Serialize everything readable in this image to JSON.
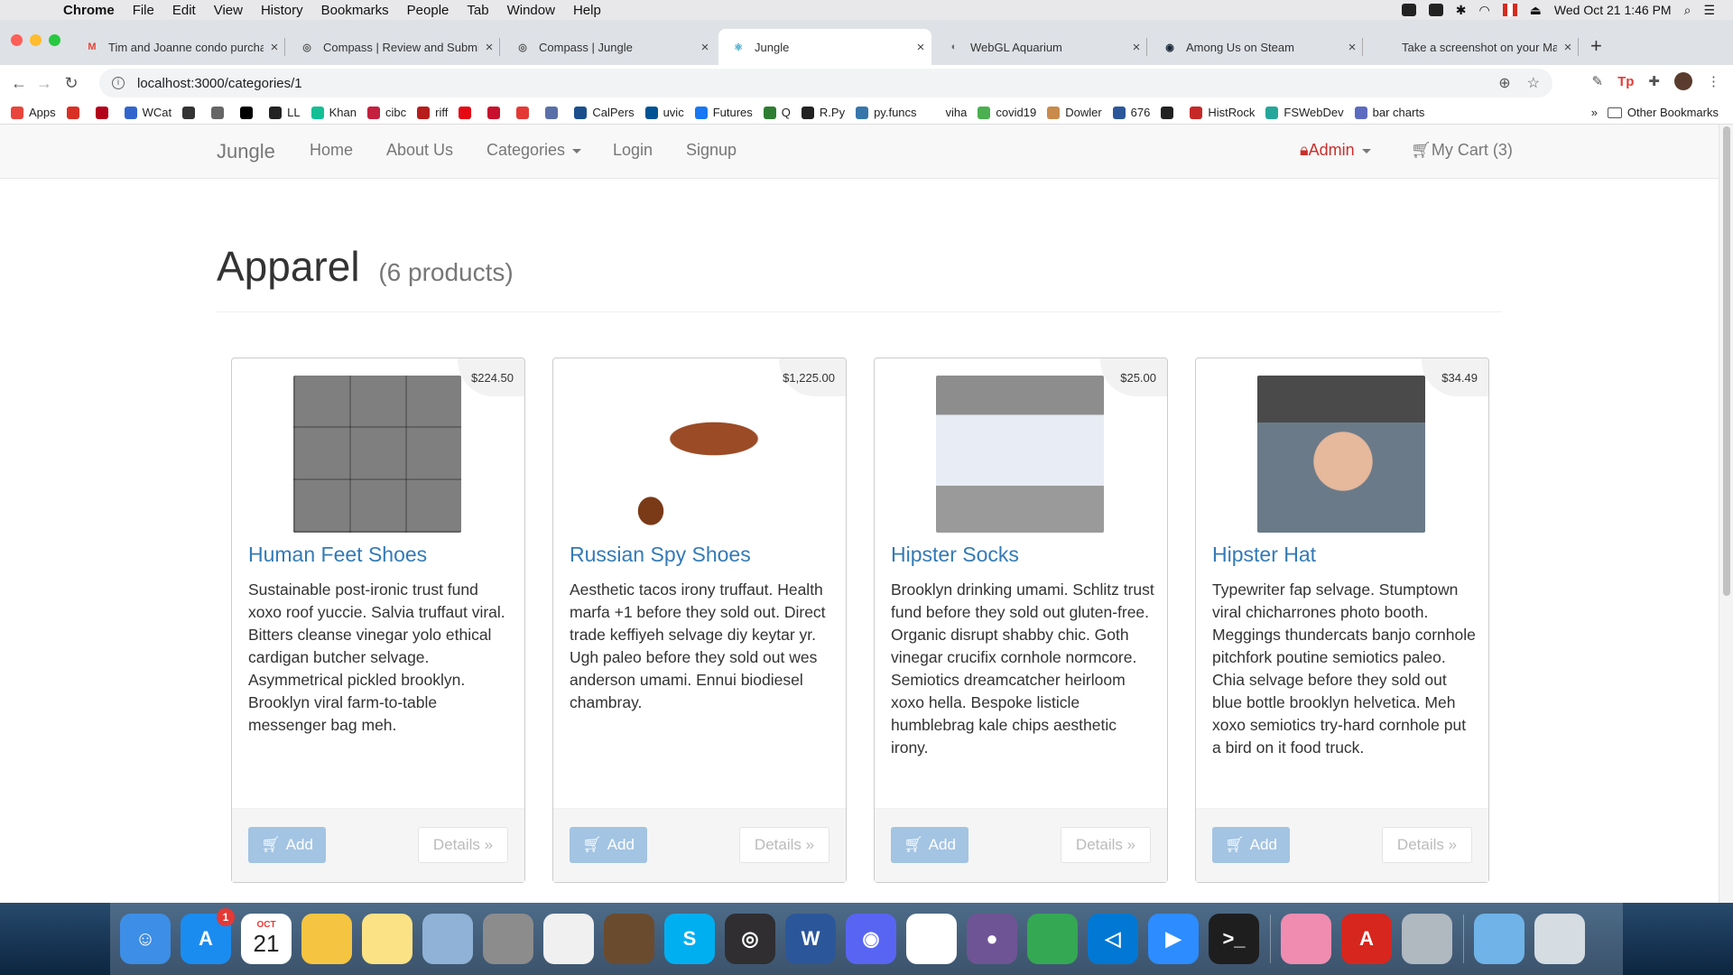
{
  "menubar": {
    "app": "Chrome",
    "items": [
      "File",
      "Edit",
      "View",
      "History",
      "Bookmarks",
      "People",
      "Tab",
      "Window",
      "Help"
    ],
    "clock": "Wed Oct 21  1:46 PM"
  },
  "tabs": [
    {
      "title": "Tim and Joanne condo purcha",
      "icon": "gmail-icon",
      "color": "#ea4335",
      "glyph": "M"
    },
    {
      "title": "Compass | Review and Submit",
      "icon": "compass-icon",
      "color": "#555555",
      "glyph": "◎"
    },
    {
      "title": "Compass | Jungle",
      "icon": "compass-icon",
      "color": "#555555",
      "glyph": "◎"
    },
    {
      "title": "Jungle",
      "icon": "react-icon",
      "color": "#3fa7c9",
      "glyph": "⚛"
    },
    {
      "title": "WebGL Aquarium",
      "icon": "globe-icon",
      "color": "#666666",
      "glyph": "◐"
    },
    {
      "title": "Among Us on Steam",
      "icon": "steam-icon",
      "color": "#1b2838",
      "glyph": "◉"
    },
    {
      "title": "Take a screenshot on your Mac",
      "icon": "apple-icon",
      "color": "#888888",
      "glyph": ""
    }
  ],
  "address": {
    "url": "localhost:3000/categories/1"
  },
  "bookmarks": [
    {
      "label": "Apps",
      "color": "#e8453c"
    },
    {
      "label": "",
      "color": "#d93025"
    },
    {
      "label": "",
      "color": "#b3001b"
    },
    {
      "label": "WCat",
      "color": "#3366cc"
    },
    {
      "label": "",
      "color": "#333333"
    },
    {
      "label": "",
      "color": "#666666"
    },
    {
      "label": "",
      "color": "#000000"
    },
    {
      "label": "LL",
      "color": "#222222"
    },
    {
      "label": "Khan",
      "color": "#14bf96"
    },
    {
      "label": "cibc",
      "color": "#c41f3e"
    },
    {
      "label": "riff",
      "color": "#b71c1c"
    },
    {
      "label": "",
      "color": "#e50914"
    },
    {
      "label": "",
      "color": "#c8102e"
    },
    {
      "label": "",
      "color": "#e53935"
    },
    {
      "label": "",
      "color": "#5a6ea8"
    },
    {
      "label": "CalPers",
      "color": "#1a4f8b"
    },
    {
      "label": "uvic",
      "color": "#005493"
    },
    {
      "label": "Futures",
      "color": "#1877f2"
    },
    {
      "label": "Q",
      "color": "#2e7d32"
    },
    {
      "label": "R.Py",
      "color": "#222222"
    },
    {
      "label": "py.funcs",
      "color": "#3776ab"
    },
    {
      "label": "viha",
      "color": "#ffffff"
    },
    {
      "label": "covid19",
      "color": "#4caf50"
    },
    {
      "label": "Dowler",
      "color": "#c98a4b"
    },
    {
      "label": "676",
      "color": "#2b579a"
    },
    {
      "label": "",
      "color": "#222222"
    },
    {
      "label": "HistRock",
      "color": "#c62828"
    },
    {
      "label": "FSWebDev",
      "color": "#26a69a"
    },
    {
      "label": "bar charts",
      "color": "#5c6bc0"
    }
  ],
  "bookmarks_overflow": "»",
  "other_bookmarks": "Other Bookmarks",
  "nav": {
    "brand": "Jungle",
    "home": "Home",
    "about": "About Us",
    "categories": "Categories",
    "login": "Login",
    "signup": "Signup",
    "admin": "Admin",
    "cart": "My Cart (3)"
  },
  "category": {
    "title": "Apparel",
    "count": "(6 products)"
  },
  "products": [
    {
      "name": "Human Feet Shoes",
      "price": "$224.50",
      "image": "human-feet-shoes-image",
      "description": "Sustainable post-ironic trust fund xoxo roof yuccie. Salvia truffaut viral. Bitters cleanse vinegar yolo ethical cardigan butcher selvage. Asymmetrical pickled brooklyn. Brooklyn viral farm-to-table messenger bag meh.",
      "add": "Add",
      "details": "Details »"
    },
    {
      "name": "Russian Spy Shoes",
      "price": "$1,225.00",
      "image": "russian-spy-shoes-image",
      "description": "Aesthetic tacos irony truffaut. Health marfa +1 before they sold out. Direct trade keffiyeh selvage diy keytar yr. Ugh paleo before they sold out wes anderson umami. Ennui biodiesel chambray.",
      "add": "Add",
      "details": "Details »"
    },
    {
      "name": "Hipster Socks",
      "price": "$25.00",
      "image": "hipster-socks-image",
      "description": "Brooklyn drinking umami. Schlitz trust fund before they sold out gluten-free. Organic disrupt shabby chic. Goth vinegar crucifix cornhole normcore. Semiotics dreamcatcher heirloom xoxo hella. Bespoke listicle humblebrag kale chips aesthetic irony.",
      "add": "Add",
      "details": "Details »"
    },
    {
      "name": "Hipster Hat",
      "price": "$34.49",
      "image": "hipster-hat-image",
      "description": "Typewriter fap selvage. Stumptown viral chicharrones photo booth. Meggings thundercats banjo cornhole pitchfork poutine semiotics paleo. Chia selvage before they sold out blue bottle brooklyn helvetica. Meh xoxo semiotics try-hard cornhole put a bird on it food truck.",
      "add": "Add",
      "details": "Details »"
    }
  ],
  "dock": {
    "calendar_month": "OCT",
    "calendar_day": "21",
    "appstore_badge": "1",
    "apps": [
      "finder-icon",
      "app-store-icon",
      "calendar-icon",
      "photos-icon",
      "notes-icon",
      "preview-icon",
      "calculator-icon",
      "textedit-icon",
      "garageband-icon",
      "skype-icon",
      "obs-icon",
      "word-icon",
      "discord-icon",
      "slack-icon",
      "github-icon",
      "chrome-icon",
      "vscode-icon",
      "zoom-icon",
      "terminal-icon",
      "screen-icon",
      "acrobat-icon",
      "usb-icon",
      "downloads-icon",
      "trash-icon"
    ]
  }
}
